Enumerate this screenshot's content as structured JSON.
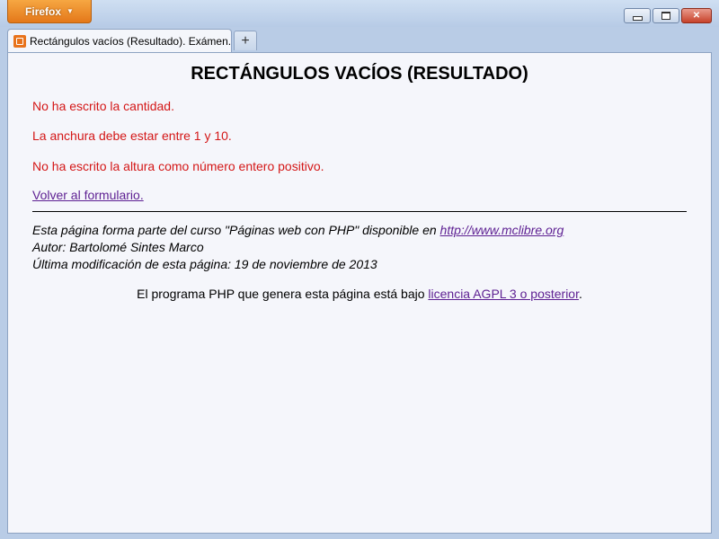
{
  "browser": {
    "menu_button": "Firefox",
    "tab_title": "Rectángulos vacíos (Resultado). Exámen...",
    "new_tab": "+",
    "close_glyph": "✕"
  },
  "page": {
    "heading": "RECTÁNGULOS VACÍOS (RESULTADO)",
    "errors": [
      "No ha escrito la cantidad.",
      "La anchura debe estar entre 1 y 10.",
      "No ha escrito la altura como número entero positivo."
    ],
    "back_link": "Volver al formulario.",
    "footer": {
      "line1_text": "Esta página forma parte del curso \"Páginas web con PHP\" disponible en ",
      "line1_link": "http://www.mclibre.org",
      "line2": "Autor: Bartolomé Sintes Marco",
      "line3": "Última modificación de esta página: 19 de noviembre de 2013"
    },
    "license": {
      "text_before": "El programa PHP que genera esta página está bajo ",
      "link": "licencia AGPL 3 o posterior",
      "text_after": "."
    }
  },
  "colors": {
    "error": "#d41717",
    "link": "#5d1f92",
    "page_bg": "#f5f6fb",
    "firefox_button": "#e4781a"
  }
}
